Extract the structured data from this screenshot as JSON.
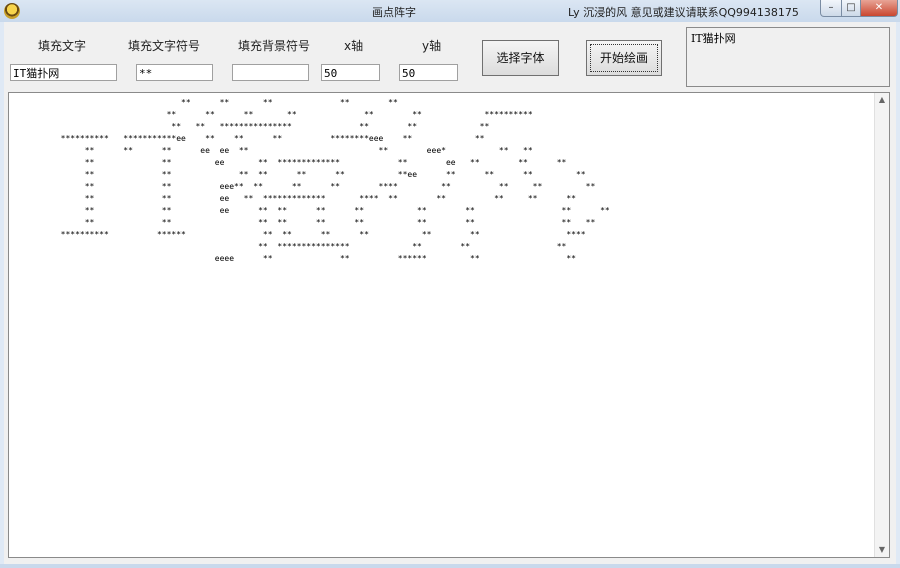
{
  "window": {
    "title": "画点阵字",
    "author": "Ly 沉浸的风  意见或建议请联系QQ994138175",
    "controls": {
      "minimize": "–",
      "maximize": "□",
      "close": "✕"
    }
  },
  "form": {
    "fill_text_label": "填充文字",
    "fill_text_value": "IT猫扑网",
    "fill_symbol_label": "填充文字符号",
    "fill_symbol_value": "**",
    "background_symbol_label": "填充背景符号",
    "background_symbol_value": "",
    "x_label": "x轴",
    "x_value": "50",
    "y_label": "y轴",
    "y_value": "50",
    "choose_font_button": "选择字体",
    "start_draw_button": "开始绘画",
    "font_preview_text": "IT猫扑网"
  },
  "output": {
    "ascii_art": "                           **      **       **              **        **\n                        **      **      **       **              **        **             **********\n                         **   **   ***************              **        **             **\n  **********   ***********ee    **    **      **          ********eee    **             **\n       **      **      **      ee  ee  **                           **        eee*           **   **\n       **              **         ee       **  *************            **        ee   **        **      **\n       **              **              **  **      **      **           **ee      **      **      **         **\n       **              **          eee**  **      **      **        ****         **          **     **         **\n       **              **          ee   **  *************       ****  **        **          **     **      **\n       **              **          ee      **  **      **      **           **        **                  **      **\n       **              **                  **  **      **      **           **        **                  **   **\n  **********          ******                **  **      **      **           **        **                  ****\n                                           **  ***************             **        **                  **\n                                  eeee      **              **          ******         **                  **"
  }
}
